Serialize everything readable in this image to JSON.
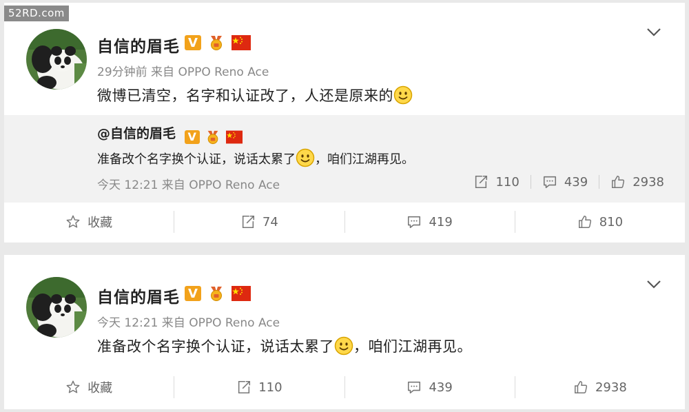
{
  "watermark": "52RD.com",
  "colors": {
    "accent": "#f2a21b",
    "flag": "#de2910",
    "text": "#222222",
    "muted": "#888888"
  },
  "post1": {
    "username": "自信的眉毛",
    "meta": "29分钟前 来自 OPPO Reno Ace",
    "text": "微博已清空，名字和认证改了，人还是原来的",
    "repost": {
      "username": "@自信的眉毛",
      "text_a": "准备改个名字换个认证，说话太累了",
      "text_b": "，咱们江湖再见。",
      "meta": "今天 12:21 来自 OPPO Reno Ace",
      "reposts": "110",
      "comments": "439",
      "likes": "2938"
    },
    "actions": {
      "favorite": "收藏",
      "reposts": "74",
      "comments": "419",
      "likes": "810"
    }
  },
  "post2": {
    "username": "自信的眉毛",
    "meta": "今天 12:21 来自 OPPO Reno Ace",
    "text_a": "准备改个名字换个认证，说话太累了",
    "text_b": "，咱们江湖再见。",
    "actions": {
      "favorite": "收藏",
      "reposts": "110",
      "comments": "439",
      "likes": "2938"
    }
  },
  "icons": [
    "star-icon",
    "repost-icon",
    "comment-icon",
    "thumbs-up-icon",
    "chevron-down-icon",
    "smile-emoji-icon",
    "verified-v-icon",
    "medal-icon",
    "china-flag-icon"
  ]
}
